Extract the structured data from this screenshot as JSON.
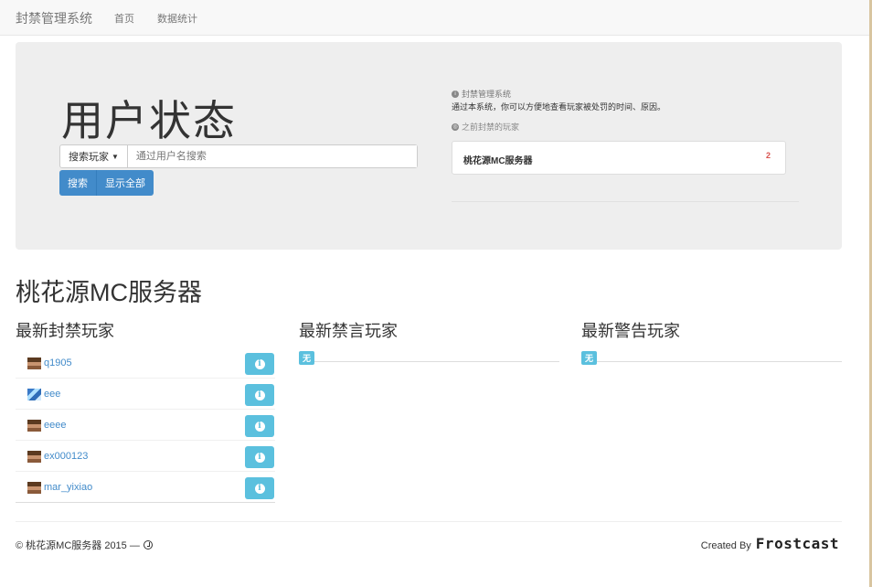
{
  "navbar": {
    "brand": "封禁管理系统",
    "links": [
      "首页",
      "数据统计"
    ]
  },
  "jumbotron": {
    "title": "用户状态",
    "search_type_label": "搜索玩家",
    "search_placeholder": "通过用户名搜索",
    "search_button": "搜索",
    "show_all_button": "显示全部",
    "info_heading": "封禁管理系统",
    "info_description": "通过本系统，你可以方便地查看玩家被处罚的时间、原因。",
    "previous_heading": "之前封禁的玩家",
    "server_card": {
      "name": "桃花源MC服务器",
      "count": "2"
    }
  },
  "main": {
    "server_title": "桃花源MC服务器",
    "columns": [
      {
        "title": "最新封禁玩家"
      },
      {
        "title": "最新禁言玩家",
        "empty_label": "无"
      },
      {
        "title": "最新警告玩家",
        "empty_label": "无"
      }
    ],
    "banned_players": [
      {
        "name": "q1905",
        "avatar": "steve-head"
      },
      {
        "name": "eee",
        "avatar": "blue-skin-head"
      },
      {
        "name": "eeee",
        "avatar": "steve-head"
      },
      {
        "name": "ex000123",
        "avatar": "steve-head"
      },
      {
        "name": "mar_yixiao",
        "avatar": "steve-head"
      }
    ]
  },
  "footer": {
    "copyright": "© 桃花源MC服务器 2015 —",
    "created_by": "Created By",
    "logo_text": "Frostcast"
  },
  "colors": {
    "primary": "#428bca",
    "info": "#5bc0de",
    "danger": "#d9534f",
    "jumbotron_bg": "#eeeeee"
  }
}
